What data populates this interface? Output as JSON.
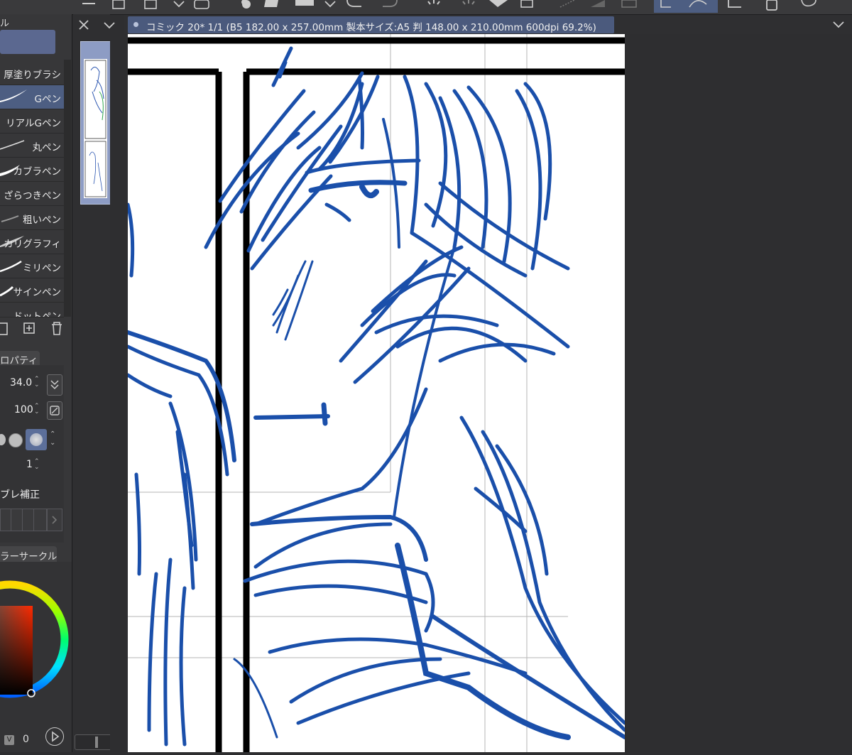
{
  "document": {
    "tab_title": "コミック 20* 1/1 (B5 182.00 x 257.00mm 製本サイズ:A5 判 148.00 x 210.00mm 600dpi 69.2%)"
  },
  "brush_panel": {
    "items": [
      {
        "label": "厚塗りブラシ"
      },
      {
        "label": "Gペン",
        "selected": true
      },
      {
        "label": "リアルGペン"
      },
      {
        "label": "丸ペン"
      },
      {
        "label": "カブラペン"
      },
      {
        "label": "ざらつきペン"
      },
      {
        "label": "粗いペン"
      },
      {
        "label": "カリグラフィ"
      },
      {
        "label": "ミリペン"
      },
      {
        "label": "サインペン"
      },
      {
        "label": "ドットペン"
      }
    ]
  },
  "properties": {
    "tab_label": "ロパティ",
    "brush_size": "34.0",
    "opacity": "100",
    "count": "1",
    "stabilizer_label": "ブレ補正"
  },
  "color_circle": {
    "tab_label": "ラーサークル",
    "v_label": "V",
    "v_value": "0",
    "accent_color": "#1a4faa"
  }
}
